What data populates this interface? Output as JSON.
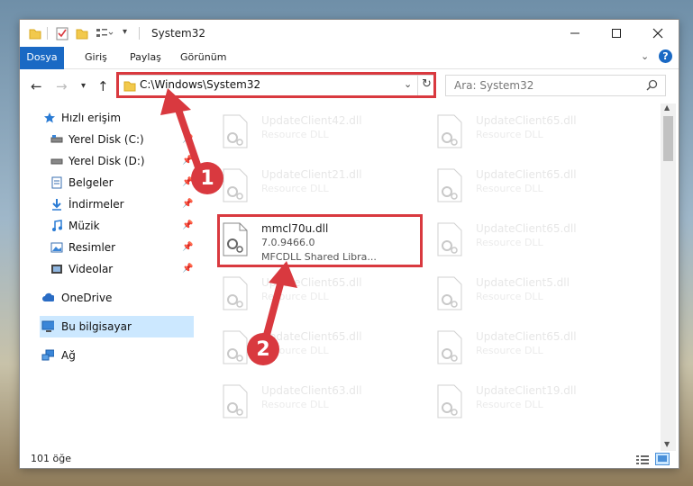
{
  "window": {
    "title": "System32"
  },
  "ribbon": {
    "tabs": [
      {
        "label": "Dosya"
      },
      {
        "label": "Giriş"
      },
      {
        "label": "Paylaş"
      },
      {
        "label": "Görünüm"
      }
    ]
  },
  "address": {
    "path": "C:\\Windows\\System32"
  },
  "search": {
    "placeholder": "Ara: System32"
  },
  "sidebar": {
    "items": [
      {
        "label": "Hızlı erişim"
      },
      {
        "label": "Yerel Disk (C:)"
      },
      {
        "label": "Yerel Disk (D:)"
      },
      {
        "label": "Belgeler"
      },
      {
        "label": "İndirmeler"
      },
      {
        "label": "Müzik"
      },
      {
        "label": "Resimler"
      },
      {
        "label": "Videolar"
      },
      {
        "label": "OneDrive"
      },
      {
        "label": "Bu bilgisayar"
      },
      {
        "label": "Ağ"
      }
    ]
  },
  "files": {
    "left": [
      {
        "name": "UpdateClient42.dll",
        "type": "Resource DLL"
      },
      {
        "name": "UpdateClient21.dll",
        "type": "Resource DLL"
      },
      {
        "name": "mmcl70u.dll",
        "version": "7.0.9466.0",
        "type": "MFCDLL Shared Libra..."
      },
      {
        "name": "UpdateClient65.dll",
        "type": "Resource DLL"
      },
      {
        "name": "UpdateClient65.dll",
        "type": "Resource DLL"
      },
      {
        "name": "UpdateClient63.dll",
        "type": "Resource DLL"
      }
    ],
    "right": [
      {
        "name": "UpdateClient65.dll",
        "type": "Resource DLL"
      },
      {
        "name": "UpdateClient65.dll",
        "type": "Resource DLL"
      },
      {
        "name": "UpdateClient65.dll",
        "type": "Resource DLL"
      },
      {
        "name": "UpdateClient5.dll",
        "type": "Resource DLL"
      },
      {
        "name": "UpdateClient65.dll",
        "type": "Resource DLL"
      },
      {
        "name": "UpdateClient19.dll",
        "type": "Resource DLL"
      }
    ]
  },
  "status": {
    "count": "101 öğe"
  },
  "annotations": {
    "badge1": "1",
    "badge2": "2"
  },
  "colors": {
    "accent": "#1a69c4",
    "highlight": "#d9393f",
    "selection": "#cce8ff"
  }
}
